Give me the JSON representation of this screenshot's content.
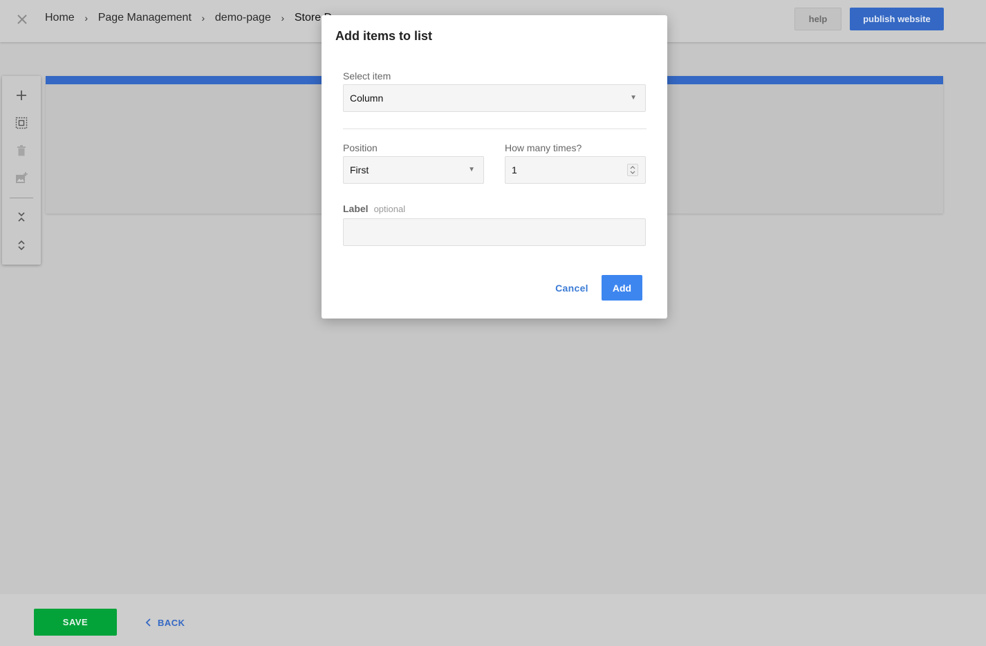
{
  "header": {
    "breadcrumbs": [
      "Home",
      "Page Management",
      "demo-page",
      "Store D"
    ],
    "help_label": "help",
    "publish_label": "publish website"
  },
  "toolbar": {
    "icons": [
      "add-icon",
      "select-all-icon",
      "delete-icon",
      "add-image-icon",
      "collapse-icon",
      "expand-icon"
    ]
  },
  "modal": {
    "title": "Add items to list",
    "select_item_label": "Select item",
    "select_item_value": "Column",
    "position_label": "Position",
    "position_value": "First",
    "times_label": "How many times?",
    "times_value": "1",
    "label_label": "Label",
    "label_hint": "optional",
    "label_value": "",
    "cancel_label": "Cancel",
    "add_label": "Add"
  },
  "footer": {
    "save_label": "SAVE",
    "back_label": "BACK"
  },
  "colors": {
    "primary_blue": "#3468c4",
    "dialog_blue": "#3d86f0",
    "save_green": "#04a33a"
  }
}
